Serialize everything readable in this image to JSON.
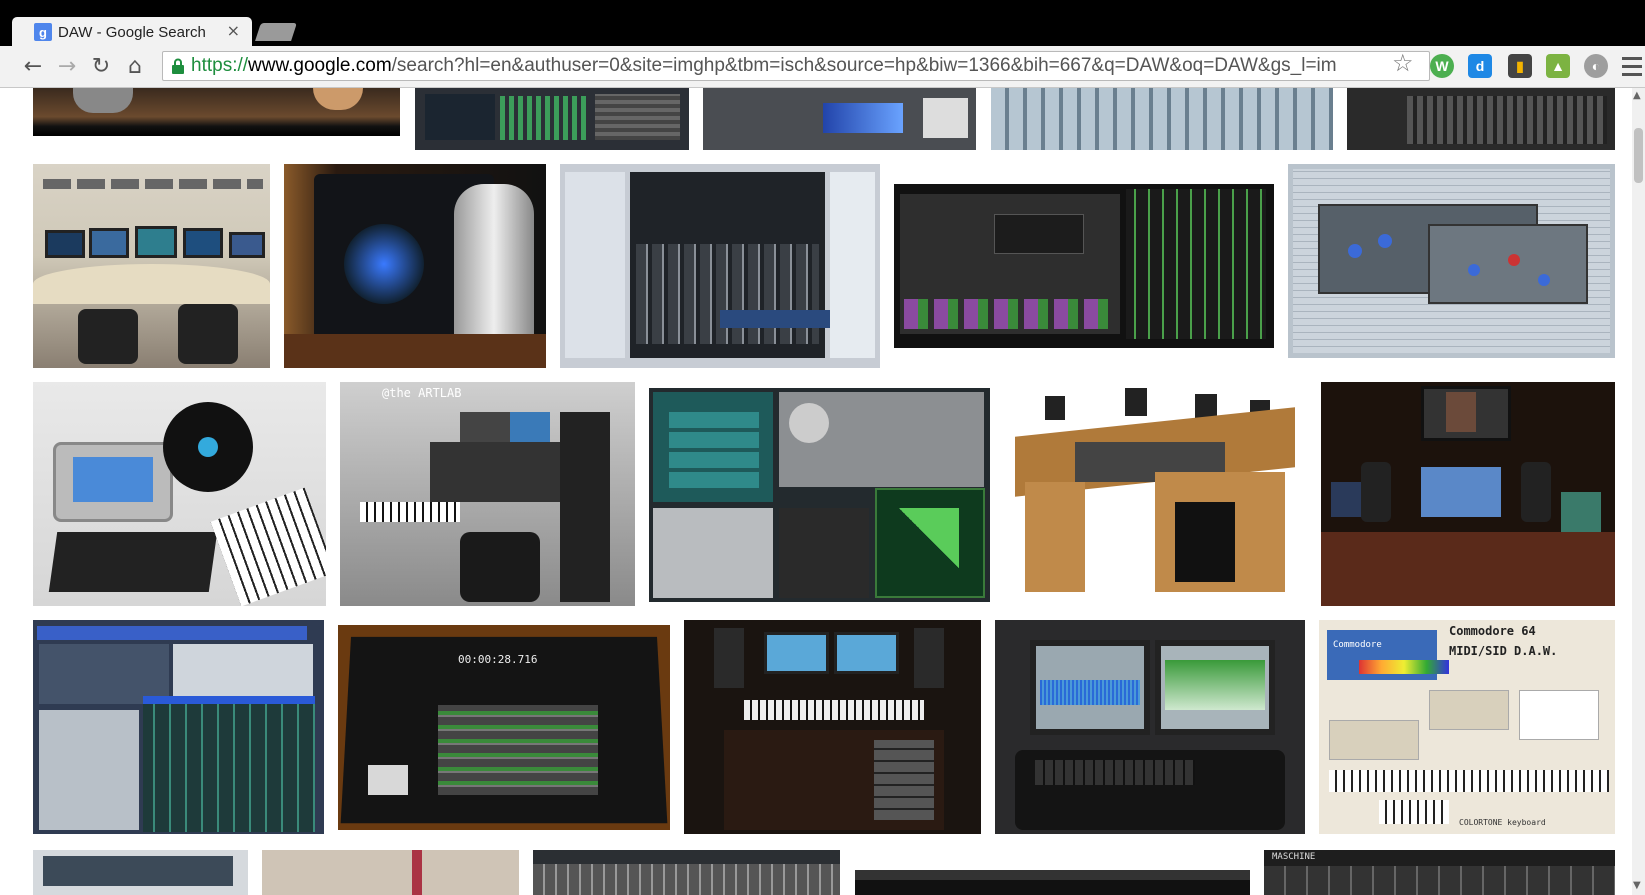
{
  "tab": {
    "title": "DAW - Google Search",
    "favicon_letter": "g",
    "close_glyph": "×"
  },
  "toolbar": {
    "back_glyph": "←",
    "forward_glyph": "→",
    "reload_glyph": "↻",
    "home_glyph": "⌂",
    "url_scheme": "https://",
    "url_host": "www.google.com",
    "url_path": "/search?hl=en&authuser=0&site=imghp&tbm=isch&source=hp&biw=1366&bih=667&q=DAW&oq=DAW&gs_l=im",
    "star_glyph": "☆",
    "extensions": [
      {
        "icon": "w-extension-icon",
        "letter": "W",
        "color": "#4caf50"
      },
      {
        "icon": "d-extension-icon",
        "letter": "d",
        "color": "#1e88e5"
      },
      {
        "icon": "tag-extension-icon",
        "letter": "▮",
        "color": "#f4b400"
      },
      {
        "icon": "green-extension-icon",
        "letter": "▲",
        "color": "#7cb342"
      },
      {
        "icon": "shield-extension-icon",
        "letter": "◐",
        "color": "#9e9e9e"
      }
    ]
  },
  "results": {
    "image_texts": {
      "artlab": "@the ARTLAB",
      "commodore_title": "Commodore 64",
      "commodore_subtitle": "MIDI/SID D.A.W.",
      "commodore_brand": "Commodore",
      "colortone": "COLORTONE keyboard",
      "maschine": "MASCHINE",
      "timecode": "00:00:28.716"
    },
    "colors": {
      "accent_green": "#1e8e3e"
    }
  },
  "scroll": {
    "up_glyph": "▲",
    "down_glyph": "▼"
  }
}
